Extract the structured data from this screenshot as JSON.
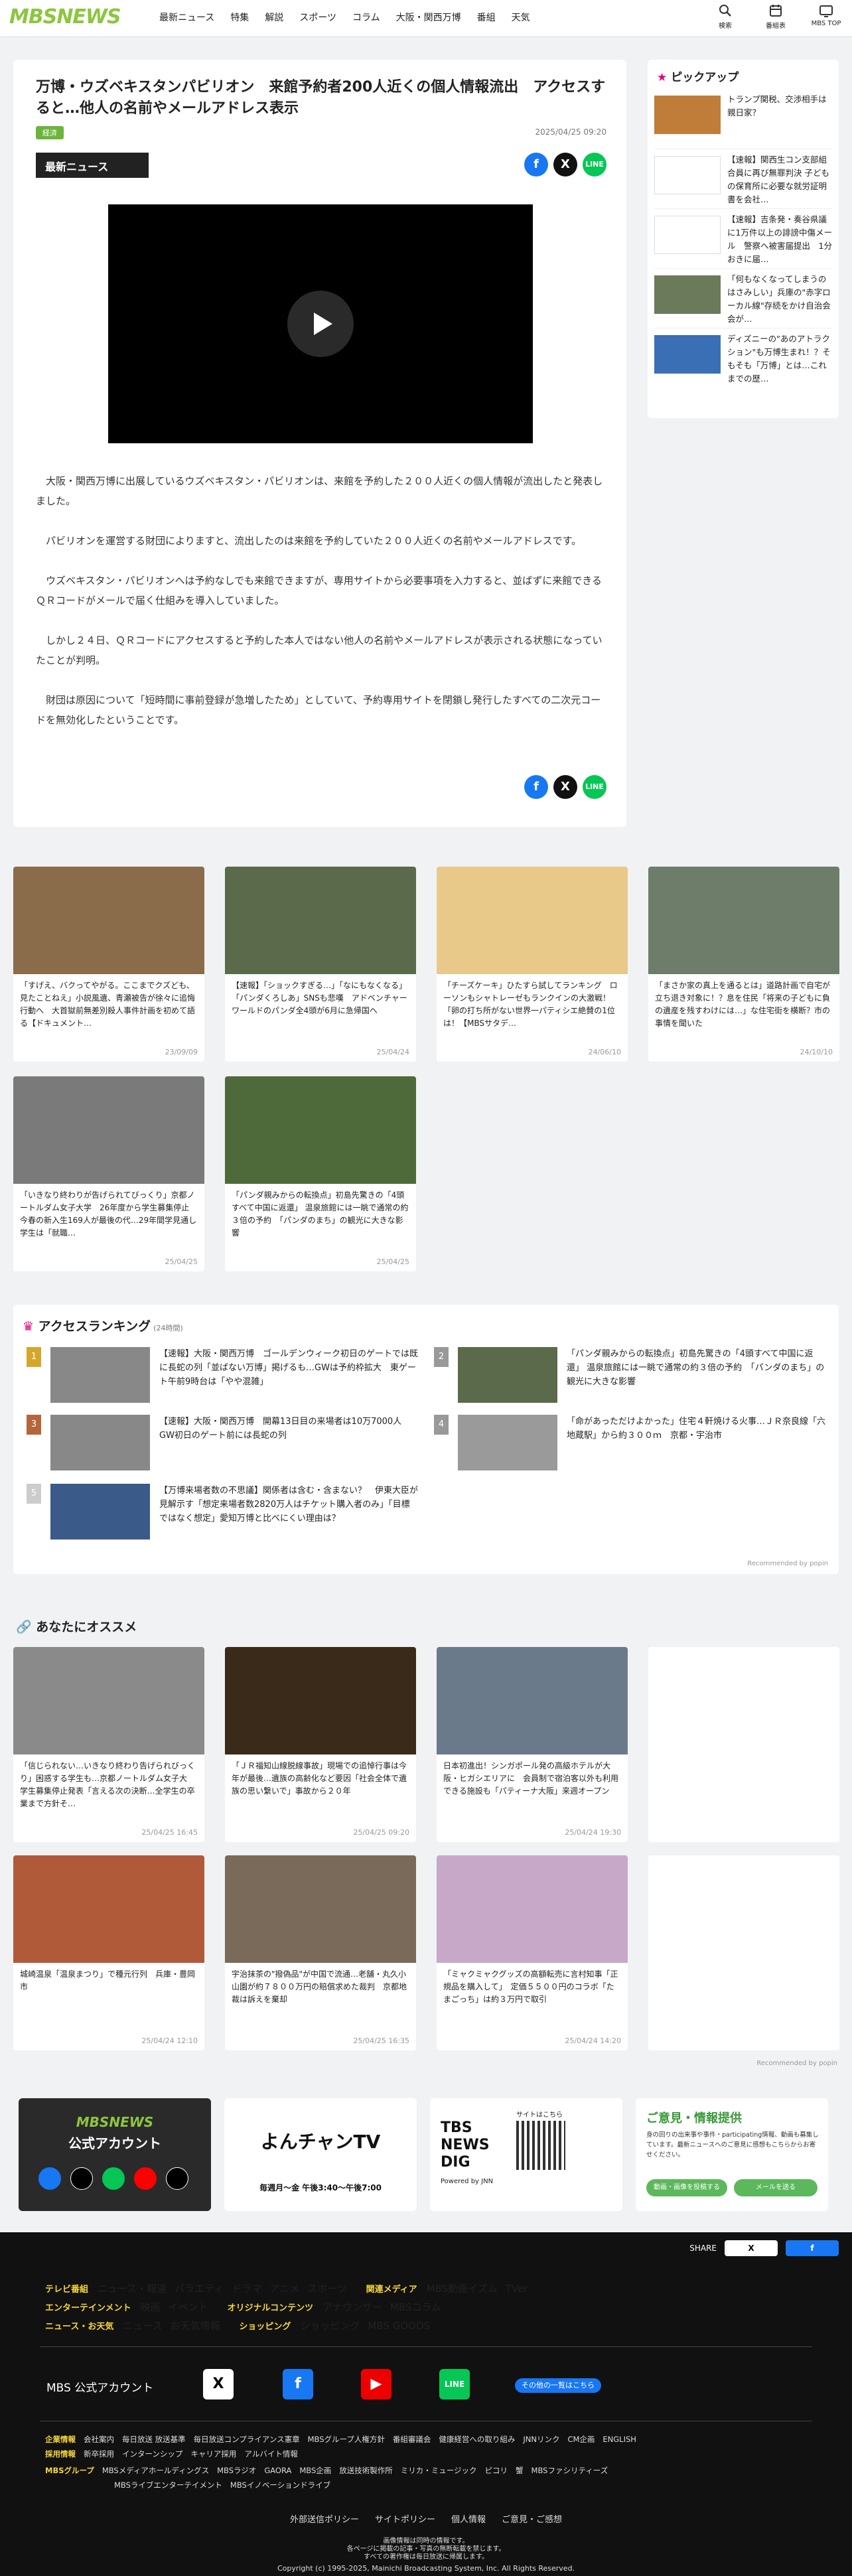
{
  "header": {
    "logo": "MBSNEWS",
    "nav": [
      "最新ニュース",
      "特集",
      "解説",
      "スポーツ",
      "コラム",
      "大阪・関西万博",
      "番組",
      "天気"
    ],
    "icons": [
      {
        "label": "検索",
        "icon": "search-icon"
      },
      {
        "label": "番組表",
        "icon": "calendar-icon"
      },
      {
        "label": "MBS TOP",
        "icon": "tv-icon"
      }
    ]
  },
  "article": {
    "title": "万博・ウズベキスタンパビリオン　来館予約者200人近くの個人情報流出　アクセスすると…他人の名前やメールアドレス表示",
    "tag": "経済",
    "date": "2025/04/25 09:20",
    "band": "最新ニュース",
    "paragraphs": [
      "大阪・関西万博に出展しているウズベキスタン・パビリオンは、来館を予約した２００人近くの個人情報が流出したと発表しました。",
      "パビリオンを運営する財団によりますと、流出したのは来館を予約していた２００人近くの名前やメールアドレスです。",
      "ウズベキスタン・パビリオンへは予約なしでも来館できますが、専用サイトから必要事項を入力すると、並ばずに来館できるＱＲコードがメールで届く仕組みを導入していました。",
      "しかし２４日、ＱＲコードにアクセスすると予約した本人ではない他人の名前やメールアドレスが表示される状態になっていたことが判明。",
      "財団は原因について「短時間に事前登録が急増したため」としていて、予約専用サイトを閉鎖し発行したすべての二次元コードを無効化したということです。"
    ]
  },
  "pickup": {
    "heading": "ピックアップ",
    "items": [
      "トランプ関税、交渉相手は親日家？",
      "【速報】関西生コン支部組合員に再び無罪判決 子どもの保育所に必要な就労証明書を会社…",
      "【速報】吉条発・奏谷県議に1万件以上の誹謗中傷メール　警察へ被害届提出　1分おきに届…",
      "「何もなくなってしまうのはさみしい」兵庫の\"赤字ローカル線\"存続をかけ自治会会が…",
      "ディズニーの\"あのアトラクション\"も万博生まれ！？そもそも「万博」とは…これまでの歴…"
    ]
  },
  "grid1": [
    {
      "text": "「すげえ、バクってやがる。ここまでクズども、見たことねえ」小説風遺、青瀬被告が徐々に追悔行動へ　大首獄前無差別殺人事件計画を初めて語る【ドキュメント…",
      "date": "23/09/09"
    },
    {
      "text": "【速報】「ショックすぎる…」「なにもなくなる」「パンダくろしあ」SNSも悲嘆　アドベンチャーワールドのパンダ全4頭が6月に急帰国へ",
      "date": "25/04/24"
    },
    {
      "text": "「チーズケーキ」ひたすら試してランキング　ローソンもシャトレーゼもランクインの大激戦！「卵の打ち所がない世界一パティシエ絶賛の1位は！【MBSサタデ…",
      "date": "24/06/10"
    },
    {
      "text": "「まさか家の真上を通るとは」道路計画で自宅が立ち退き対象に！？息を住民「将来の子どもに負の遺産を残すわけには…」な住宅街を横断？市の事情を聞いた",
      "date": "24/10/10"
    }
  ],
  "grid2": [
    {
      "text": "「いきなり終わりが告げられてびっくり」京都ノートルダム女子大学　26年度から学生募集停止　今春の新入生169人が最後の代…29年間学見通し　学生は「就職…",
      "date": "25/04/25"
    },
    {
      "text": "「パンダ親みからの転換点」初島先驚きの「4頭すべて中国に返還」 温泉旅館には一眺で通常の約３倍の予約　「パンダのまち」の観光に大きな影響",
      "date": "25/04/25"
    }
  ],
  "ranking": {
    "heading": "アクセスランキング",
    "sub": "(24時間)",
    "credit": "Recommended by popin",
    "items": [
      {
        "rank": "1",
        "text": "【速報】大阪・関西万博　ゴールデンウィーク初日のゲートでは既に長蛇の列「並ばない万博」掲げるも…GWは予約枠拡大　東ゲート午前9時台は「やや混雑」",
        "color": "#d4a72c"
      },
      {
        "rank": "2",
        "text": "「パンダ親みからの転換点」初島先驚きの「4頭すべて中国に返還」 温泉旅館には一眺で通常の約３倍の予約　「パンダのまち」の観光に大きな影響",
        "color": "#999"
      },
      {
        "rank": "3",
        "text": "【速報】大阪・関西万博　開幕13日目の来場者は10万7000人　GW初日のゲート前には長蛇の列",
        "color": "#b3663a"
      },
      {
        "rank": "4",
        "text": "「命があっただけよかった」住宅４軒焼ける火事…ＪＲ奈良線「六地蔵駅」から約３００ｍ　京都・宇治市",
        "color": "#999"
      },
      {
        "rank": "5",
        "text": "【万博来場者数の不思議】関係者は含む・含まない？　伊東大臣が見解示す「想定来場者数2820万人はチケット購入者のみ」「目標ではなく想定」愛知万博と比べにくい理由は？",
        "color": "#999"
      }
    ]
  },
  "recommend": {
    "heading": "あなたにオススメ",
    "credit": "Recommended by popin",
    "items": [
      {
        "text": "「信じられない…いきなり終わり告げられびっくり」困惑する学生も…京都ノートルダム女子大　学生募集停止発表「言える次の決断…全学生の卒業まで方針そ…",
        "date": "25/04/25 16:45"
      },
      {
        "text": "「ＪＲ福知山線脱線事故」現場での追悼行事は今年が最後…遺族の高齢化など要因「社会全体で遺族の思い繋いで」事故から２０年",
        "date": "25/04/25 09:20"
      },
      {
        "text": "日本初進出！シンガポール発の高級ホテルが大阪・ヒガシエリアに　会員制で宿泊客以外も利用できる施設も「パティーナ大阪」来週オープン",
        "date": "25/04/24 19:30"
      },
      {
        "text": "城崎温泉「温泉まつり」で種元行列　兵庫・豊岡市",
        "date": "25/04/24 12:10"
      },
      {
        "text": "宇治抹茶の\"撥偽品\"が中国で流通…老舗・丸久小山園が約７８００万円の賠償求めた裁判　京都地裁は訴えを棄却",
        "date": "25/04/25 16:35"
      },
      {
        "text": "「ミャクミャクグッズの高額転売に言村知事「正規品を購入して」　定価５５００円のコラボ「たまごっち」は約３万円で取引",
        "date": "25/04/24 14:20"
      }
    ]
  },
  "banners": {
    "official": {
      "title": "MBSNEWS",
      "sub": "公式アカウント"
    },
    "yonchan": {
      "title": "よんチャンTV",
      "time": "毎週月～金 午後3:40～午後7:00"
    },
    "tbs": {
      "title": "TBS NEWS DIG",
      "sub": "Powered by JNN",
      "qr": "サイトはこちら"
    },
    "opinion": {
      "title": "ご意見・情報提供",
      "desc": "身の回りの出来事や事件・participating情報、動画も募集しています。最新ニュースへのご意見に感想もこちらからお寄せください。",
      "b1": "動画・画像を投稿する",
      "b2": "メールを送る"
    }
  },
  "footer": {
    "share": "SHARE",
    "row1": [
      {
        "h": "テレビ番組",
        "items": [
          "ニュース・報道",
          "バラエティ",
          "ドラマ",
          "アニメ",
          "スポーツ"
        ]
      },
      {
        "h": "関連メディア",
        "items": [
          "MBS動画イズム",
          "TVer"
        ]
      }
    ],
    "row2": [
      {
        "h": "エンターテインメント",
        "items": [
          "映画",
          "イベント"
        ]
      },
      {
        "h": "オリジナルコンテンツ",
        "items": [
          "アナウンサー",
          "MBSコラム"
        ]
      }
    ],
    "row3": [
      {
        "h": "ニュース・お天気",
        "items": [
          "ニュース",
          "お天気情報"
        ]
      },
      {
        "h": "ショッピング",
        "items": [
          "ショッピング",
          "MBS GOODS"
        ]
      }
    ],
    "account": "MBS 公式アカウント",
    "accbtn": "その他の一覧はこちら",
    "small": [
      {
        "h": "企業情報",
        "items": [
          "会社案内",
          "毎日放送 放送基準",
          "毎日放送コンプライアンス憲章",
          "MBSグループ人権方針",
          "番組審議会",
          "健康経営への取り組み",
          "JNNリンク",
          "CM企画",
          "ENGLISH"
        ]
      },
      {
        "h": "採用情報",
        "items": [
          "新卒採用",
          "インターンシップ",
          "キャリア採用",
          "アルバイト情報"
        ]
      },
      {
        "h": "MBSグループ",
        "items": [
          "MBSメディアホールディングス",
          "MBSラジオ",
          "GAORA",
          "MBS企画",
          "放送技術製作所",
          "ミリカ・ミュージック",
          "ピコリ",
          "蟹",
          "MBSファシリティーズ",
          "MBSライブエンターテイメント",
          "MBSイノベーションドライブ"
        ]
      }
    ],
    "bottom": [
      "外部送信ポリシー",
      "サイトポリシー",
      "個人情報",
      "ご意見・ご感想"
    ],
    "notice": [
      "画像情報は同時の情報です。",
      "各ページに掲載の記事・写真の無断転載を禁じます。",
      "すべての著作権は毎日放送に帰属します。"
    ],
    "copyright": "Copyright (c) 1995-2025, Mainichi Broadcasting System, Inc. All Rights Reserved."
  }
}
